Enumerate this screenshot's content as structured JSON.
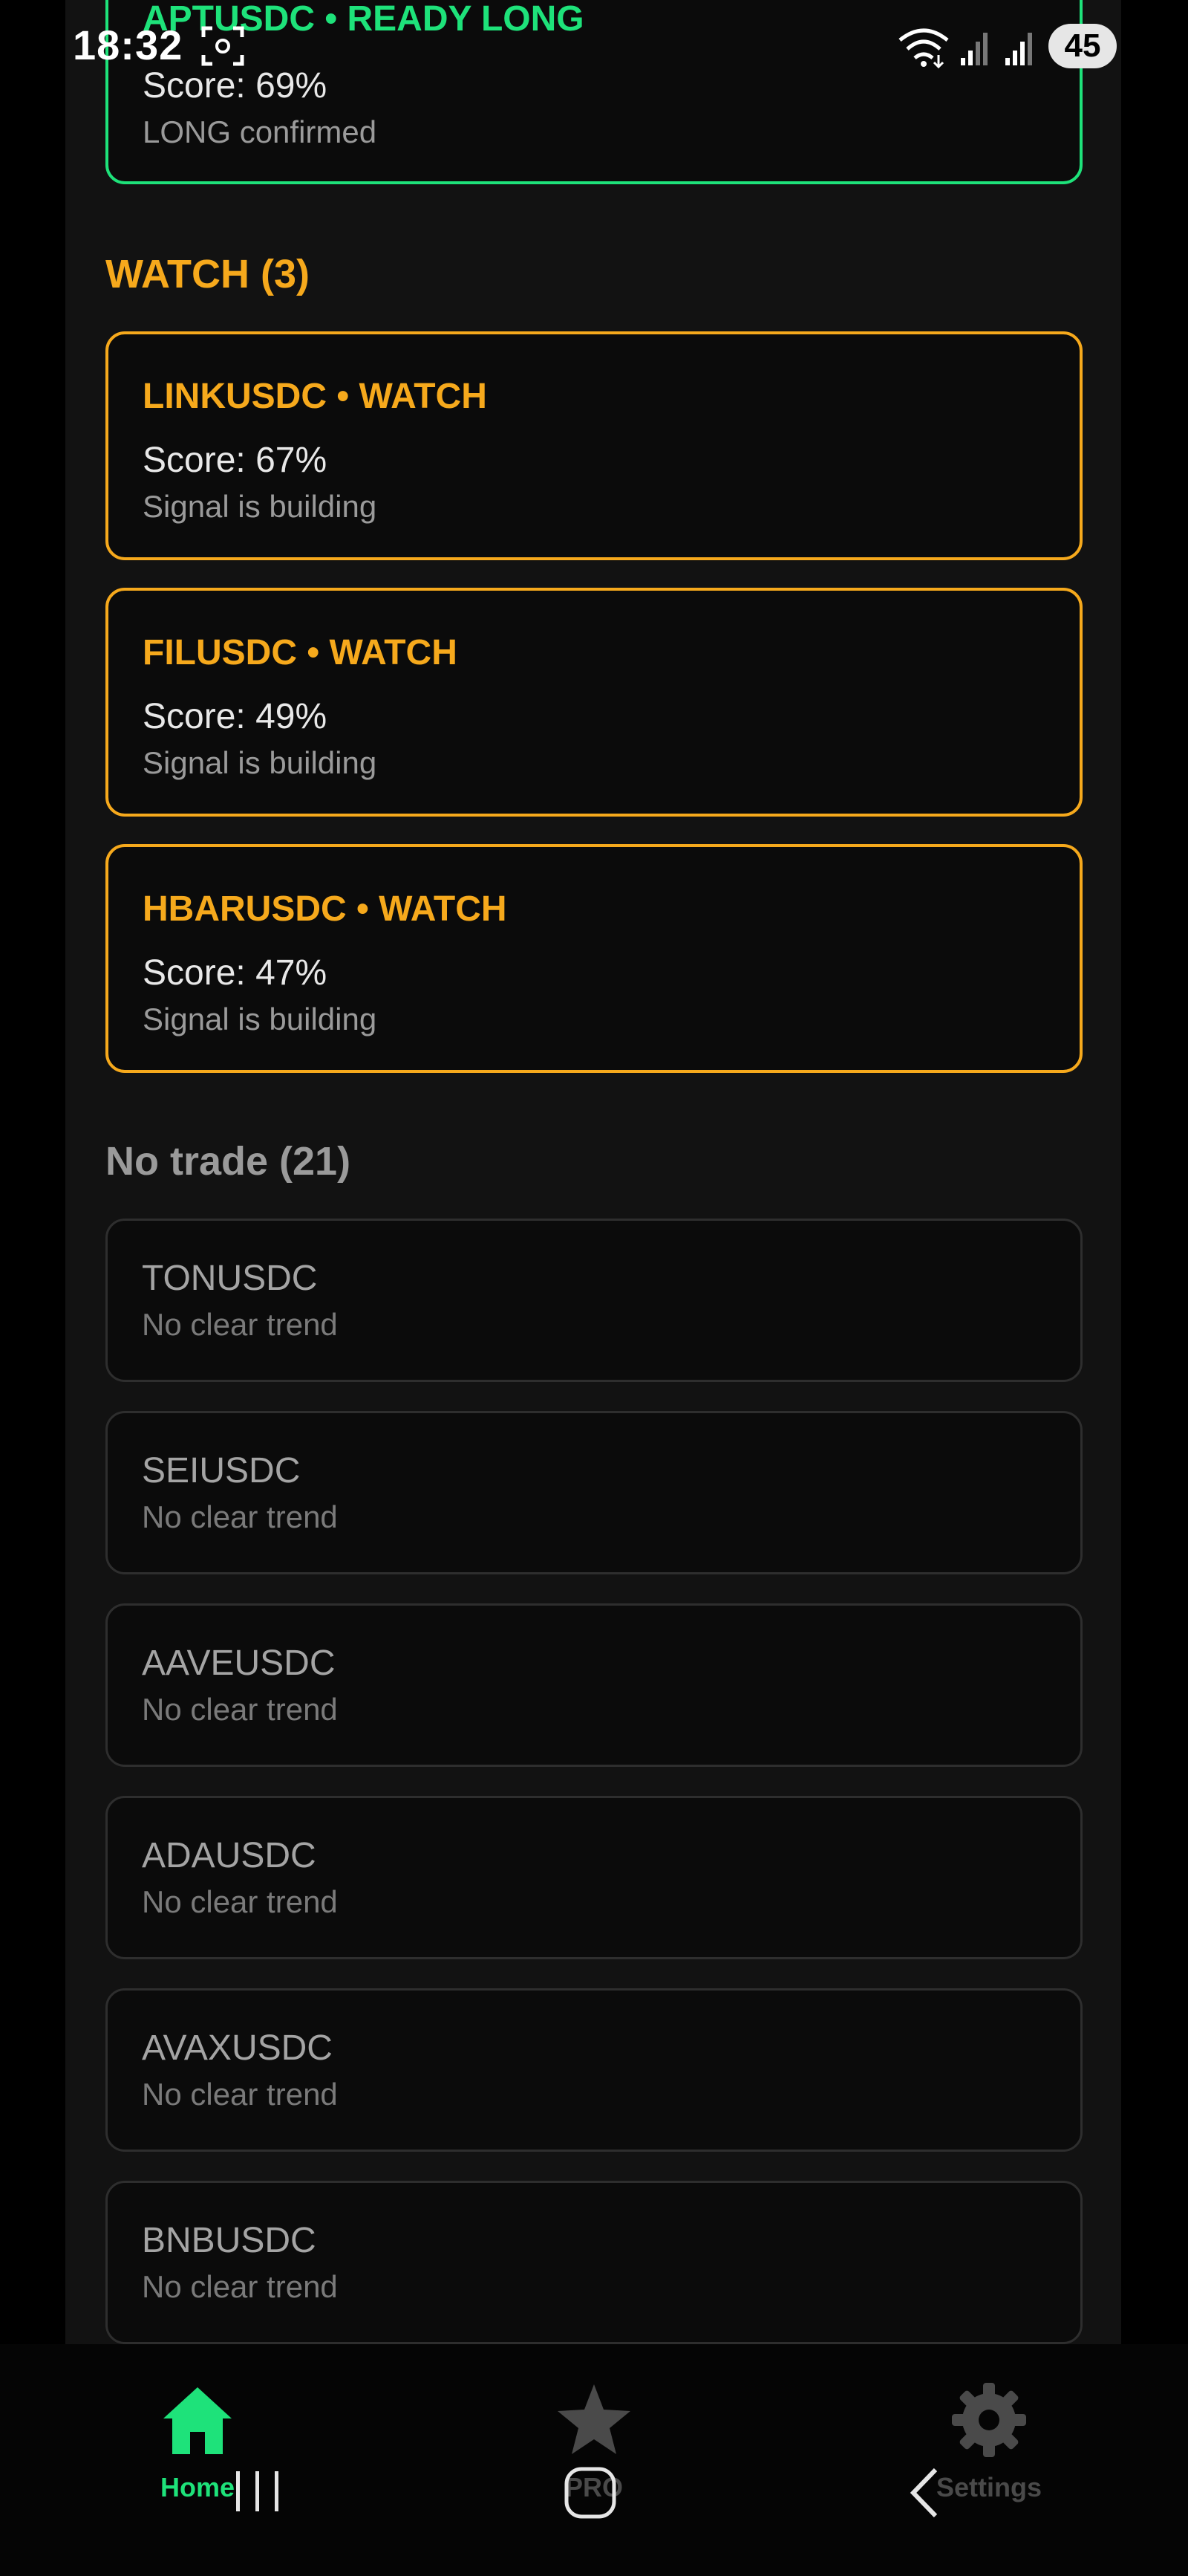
{
  "status": {
    "time": "18:32",
    "battery": "45"
  },
  "long_card": {
    "title": "APTUSDC • READY LONG",
    "score": "Score: 69%",
    "subtitle": "LONG confirmed"
  },
  "watch_section": {
    "header": "WATCH (3)",
    "items": [
      {
        "title": "LINKUSDC • WATCH",
        "score": "Score: 67%",
        "subtitle": "Signal is building"
      },
      {
        "title": "FILUSDC • WATCH",
        "score": "Score: 49%",
        "subtitle": "Signal is building"
      },
      {
        "title": "HBARUSDC • WATCH",
        "score": "Score: 47%",
        "subtitle": "Signal is building"
      }
    ]
  },
  "no_trade_section": {
    "header": "No trade (21)",
    "items": [
      {
        "symbol": "TONUSDC",
        "reason": "No clear trend"
      },
      {
        "symbol": "SEIUSDC",
        "reason": "No clear trend"
      },
      {
        "symbol": "AAVEUSDC",
        "reason": "No clear trend"
      },
      {
        "symbol": "ADAUSDC",
        "reason": "No clear trend"
      },
      {
        "symbol": "AVAXUSDC",
        "reason": "No clear trend"
      },
      {
        "symbol": "BNBUSDC",
        "reason": "No clear trend"
      }
    ]
  },
  "bottom_nav": {
    "items": [
      {
        "label": "Home",
        "icon": "home-icon",
        "active": true
      },
      {
        "label": "PRO",
        "icon": "star-icon",
        "active": false
      },
      {
        "label": "Settings",
        "icon": "gear-icon",
        "active": false
      }
    ]
  },
  "colors": {
    "long": "#1ee27a",
    "watch": "#f6a91c",
    "muted": "#9a9a9a",
    "background": "#121212"
  }
}
